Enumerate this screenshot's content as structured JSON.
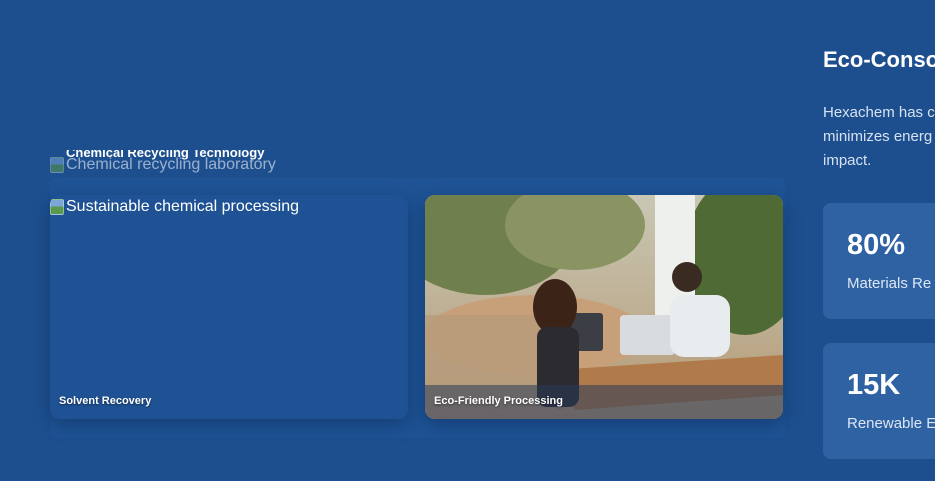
{
  "hero": {
    "title": "Chemical Recycling Technology",
    "image_alt": "Chemical recycling laboratory"
  },
  "tiles": [
    {
      "label": "Solvent Recovery",
      "image_alt": "Sustainable chemical processing"
    },
    {
      "label": "Eco-Friendly Processing"
    }
  ],
  "sidebar": {
    "title": "Eco-Conso",
    "description_lines": [
      "Hexachem has c",
      "minimizes energ",
      "impact."
    ],
    "stats": [
      {
        "value": "80%",
        "label": "Materials Re"
      },
      {
        "value": "15K",
        "label": "Renewable E"
      }
    ]
  },
  "colors": {
    "background": "#1d4f8f",
    "card": "#2f62a3",
    "text": "#ffffff"
  }
}
